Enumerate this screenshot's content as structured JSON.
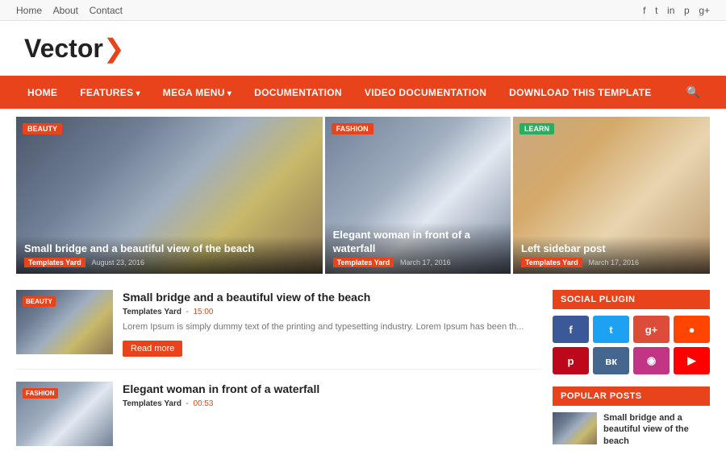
{
  "topbar": {
    "nav": [
      "Home",
      "About",
      "Contact"
    ],
    "social": [
      "f",
      "t",
      "in",
      "p",
      "g+"
    ]
  },
  "logo": {
    "text": "Vector",
    "arrow": "❯"
  },
  "nav": {
    "items": [
      {
        "label": "HOME",
        "hasArrow": false
      },
      {
        "label": "FEATURES",
        "hasArrow": true
      },
      {
        "label": "MEGA MENU",
        "hasArrow": true
      },
      {
        "label": "DOCUMENTATION",
        "hasArrow": false
      },
      {
        "label": "VIDEO DOCUMENTATION",
        "hasArrow": false
      },
      {
        "label": "DOWNLOAD THIS TEMPLATE",
        "hasArrow": false
      }
    ]
  },
  "featured": [
    {
      "cat": "BEAUTY",
      "catClass": "beauty",
      "imgClass": "img-propeller",
      "title": "Small bridge and a beautiful view of the beach",
      "author": "Templates Yard",
      "date": "August 23, 2016"
    },
    {
      "cat": "FASHION",
      "catClass": "fashion",
      "imgClass": "img-woman",
      "title": "Elegant woman in front of a waterfall",
      "author": "Templates Yard",
      "date": "March 17, 2016"
    },
    {
      "cat": "LEARN",
      "catClass": "learn",
      "imgClass": "img-desk",
      "title": "Left sidebar post",
      "author": "Templates Yard",
      "date": "March 17, 2016"
    }
  ],
  "articles": [
    {
      "cat": "BEAUTY",
      "catClass": "beauty",
      "imgClass": "img-propeller-sm",
      "title": "Small bridge and a beautiful view of the beach",
      "author": "Templates Yard",
      "time": "15:00",
      "excerpt": "Lorem Ipsum is simply dummy text of the printing and typesetting industry. Lorem Ipsum has been th...",
      "readMore": "Read more"
    },
    {
      "cat": "FASHION",
      "catClass": "fashion",
      "imgClass": "img-woman-sm",
      "title": "Elegant woman in front of a waterfall",
      "author": "Templates Yard",
      "time": "00:53"
    }
  ],
  "sidebar": {
    "socialPlugin": "SOCIAL PLUGIN",
    "popularPosts": "POPULAR POSTS",
    "social": [
      {
        "icon": "f",
        "class": "social-fb",
        "label": "facebook-icon"
      },
      {
        "icon": "t",
        "class": "social-tw",
        "label": "twitter-icon"
      },
      {
        "icon": "g+",
        "class": "social-gp",
        "label": "googleplus-icon"
      },
      {
        "icon": "●",
        "class": "social-rd",
        "label": "reddit-icon"
      },
      {
        "icon": "p",
        "class": "social-pt",
        "label": "pinterest-icon"
      },
      {
        "icon": "вк",
        "class": "social-vk",
        "label": "vk-icon"
      },
      {
        "icon": "◉",
        "class": "social-ig",
        "label": "instagram-icon"
      },
      {
        "icon": "▶",
        "class": "social-yt",
        "label": "youtube-icon"
      }
    ],
    "popularPostsList": [
      {
        "imgClass": "img-sidebar-sm",
        "title": "Small bridge and a beautiful view of the beach"
      }
    ]
  }
}
